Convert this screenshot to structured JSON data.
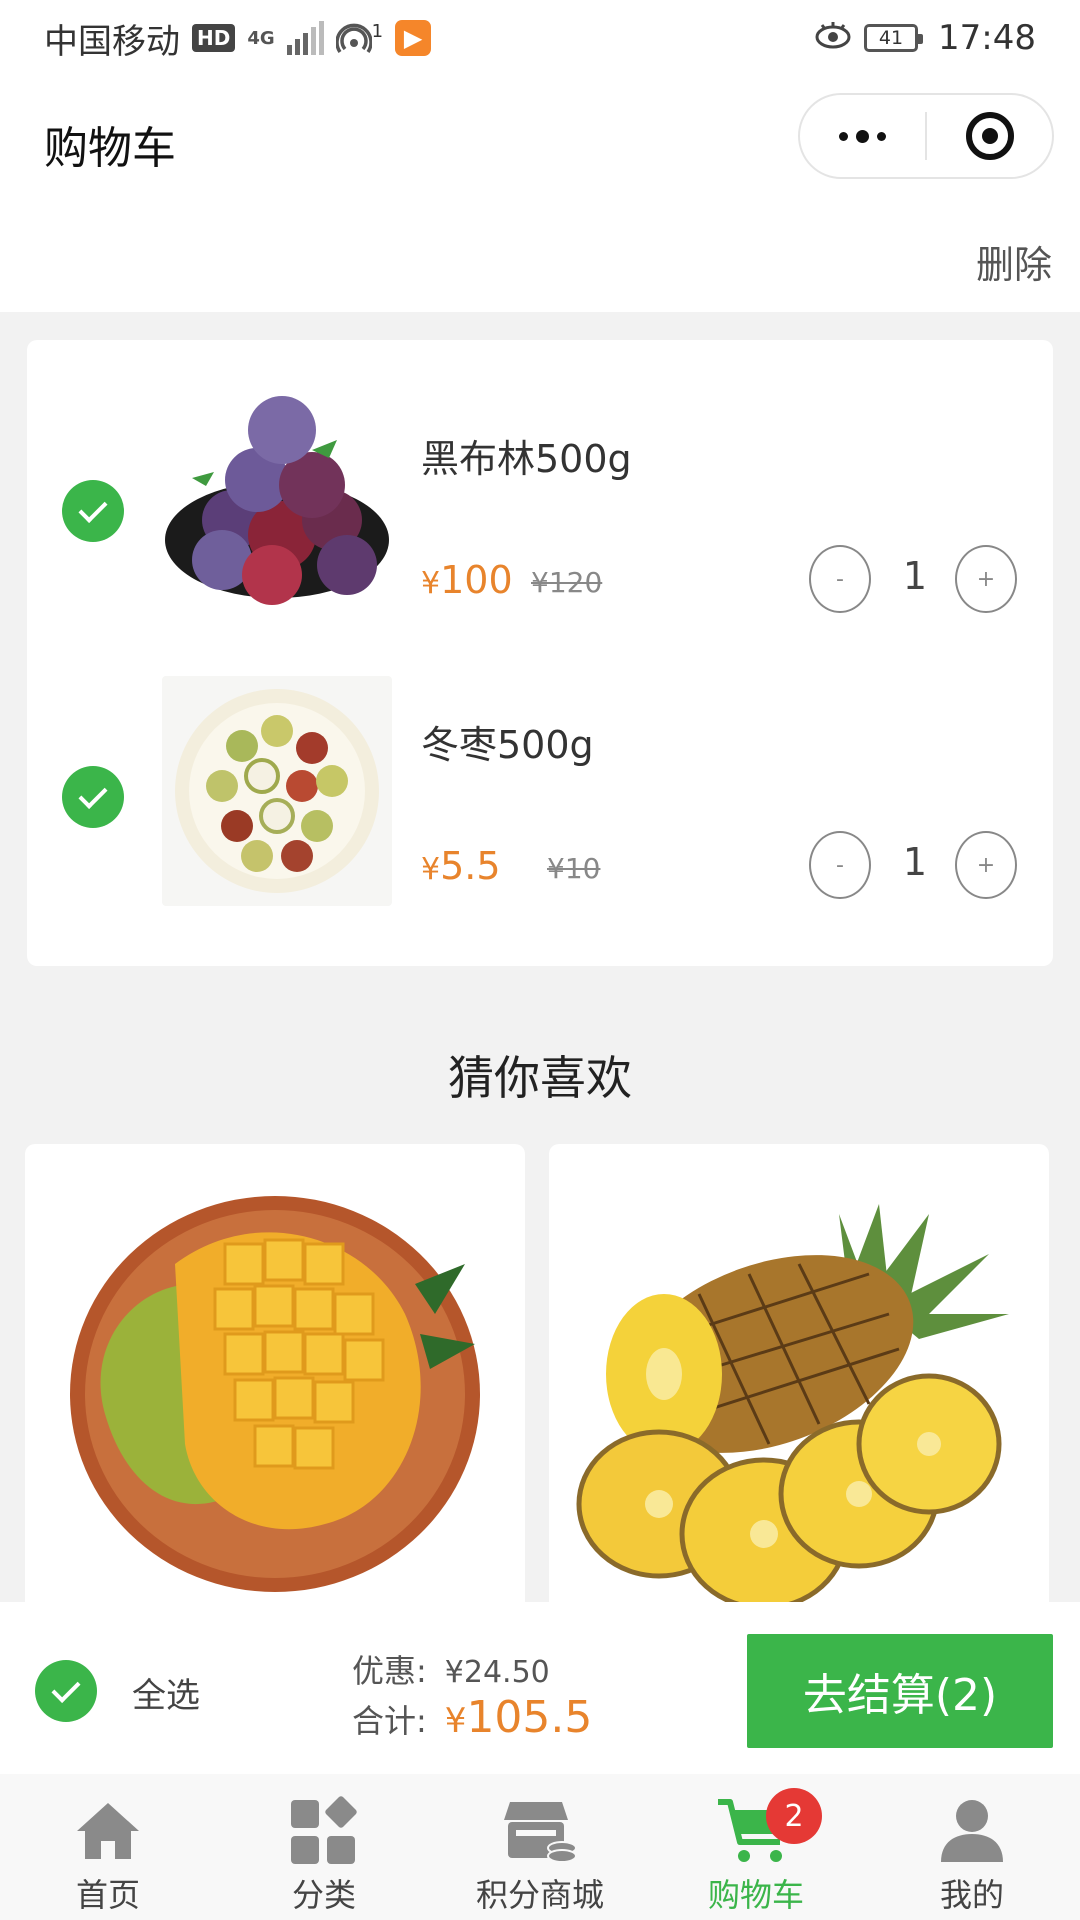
{
  "status_bar": {
    "carrier": "中国移动",
    "hd_badge": "HD",
    "network": "4G",
    "hotspot_count": "1",
    "battery": "41",
    "time": "17:48"
  },
  "nav": {
    "title": "购物车"
  },
  "toolbar": {
    "delete_label": "删除"
  },
  "cart": {
    "items": [
      {
        "name": "黑布林500g",
        "currency": "¥",
        "price": "100",
        "original_price": "¥120",
        "quantity": "1",
        "minus": "-",
        "plus": "+",
        "selected": true
      },
      {
        "name": "冬枣500g",
        "currency": "¥",
        "price": "5.5",
        "original_price": "¥10",
        "quantity": "1",
        "minus": "-",
        "plus": "+",
        "selected": true
      }
    ]
  },
  "recommend": {
    "title": "猜你喜欢",
    "items": [
      {
        "image": "mango-image"
      },
      {
        "image": "pineapple-image"
      }
    ]
  },
  "checkout": {
    "select_all_label": "全选",
    "discount_label": "优惠:",
    "discount_value": "¥24.50",
    "total_label": "合计:",
    "total_currency": "¥",
    "total_value": "105.5",
    "checkout_button": "去结算(2)"
  },
  "tab_bar": {
    "tabs": [
      {
        "label": "首页",
        "icon": "home-icon"
      },
      {
        "label": "分类",
        "icon": "category-icon"
      },
      {
        "label": "积分商城",
        "icon": "store-icon"
      },
      {
        "label": "购物车",
        "icon": "cart-icon",
        "badge": "2",
        "active": true
      },
      {
        "label": "我的",
        "icon": "user-icon"
      }
    ]
  },
  "colors": {
    "accent_green": "#3bb54a",
    "price_orange": "#e8842c",
    "badge_red": "#e53935"
  }
}
